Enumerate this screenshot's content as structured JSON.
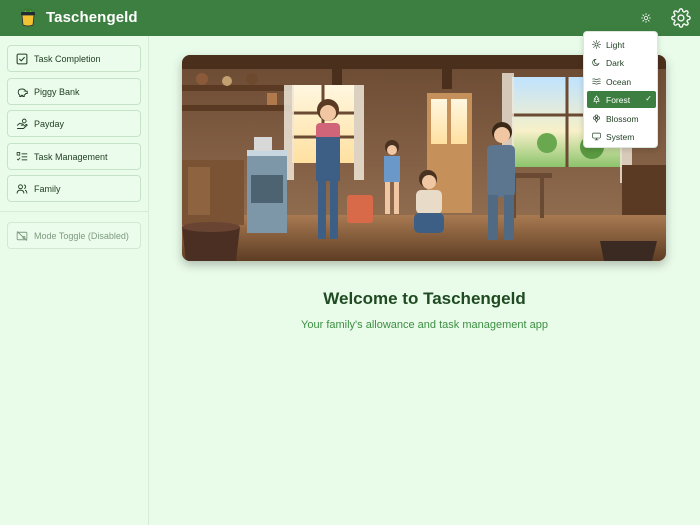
{
  "header": {
    "title": "Taschengeld",
    "logo_icon": "pot-logo-icon",
    "theme_icon": "sun-icon",
    "settings_icon": "gear-icon"
  },
  "sidebar": {
    "items": [
      {
        "label": "Task Completion",
        "icon": "checkbox-icon"
      },
      {
        "label": "Piggy Bank",
        "icon": "piggy-bank-icon"
      },
      {
        "label": "Payday",
        "icon": "payday-icon"
      },
      {
        "label": "Task Management",
        "icon": "list-check-icon"
      },
      {
        "label": "Family",
        "icon": "users-icon"
      }
    ],
    "mode_toggle": {
      "label": "Mode Toggle (Disabled)",
      "icon": "toggle-disabled-icon"
    }
  },
  "main": {
    "title": "Welcome to Taschengeld",
    "subtitle": "Your family's allowance and task management app"
  },
  "theme_menu": {
    "items": [
      {
        "label": "Light",
        "icon": "sun-icon"
      },
      {
        "label": "Dark",
        "icon": "moon-icon"
      },
      {
        "label": "Ocean",
        "icon": "waves-icon"
      },
      {
        "label": "Forest",
        "icon": "tree-icon",
        "selected": true
      },
      {
        "label": "Blossom",
        "icon": "flower-icon"
      },
      {
        "label": "System",
        "icon": "monitor-icon"
      }
    ],
    "check_glyph": "✓"
  },
  "colors": {
    "header": "#3d7f41",
    "background": "#e9fbe9",
    "accent": "#3d7f41",
    "title": "#1f4a22",
    "subtitle": "#3d8f43"
  }
}
